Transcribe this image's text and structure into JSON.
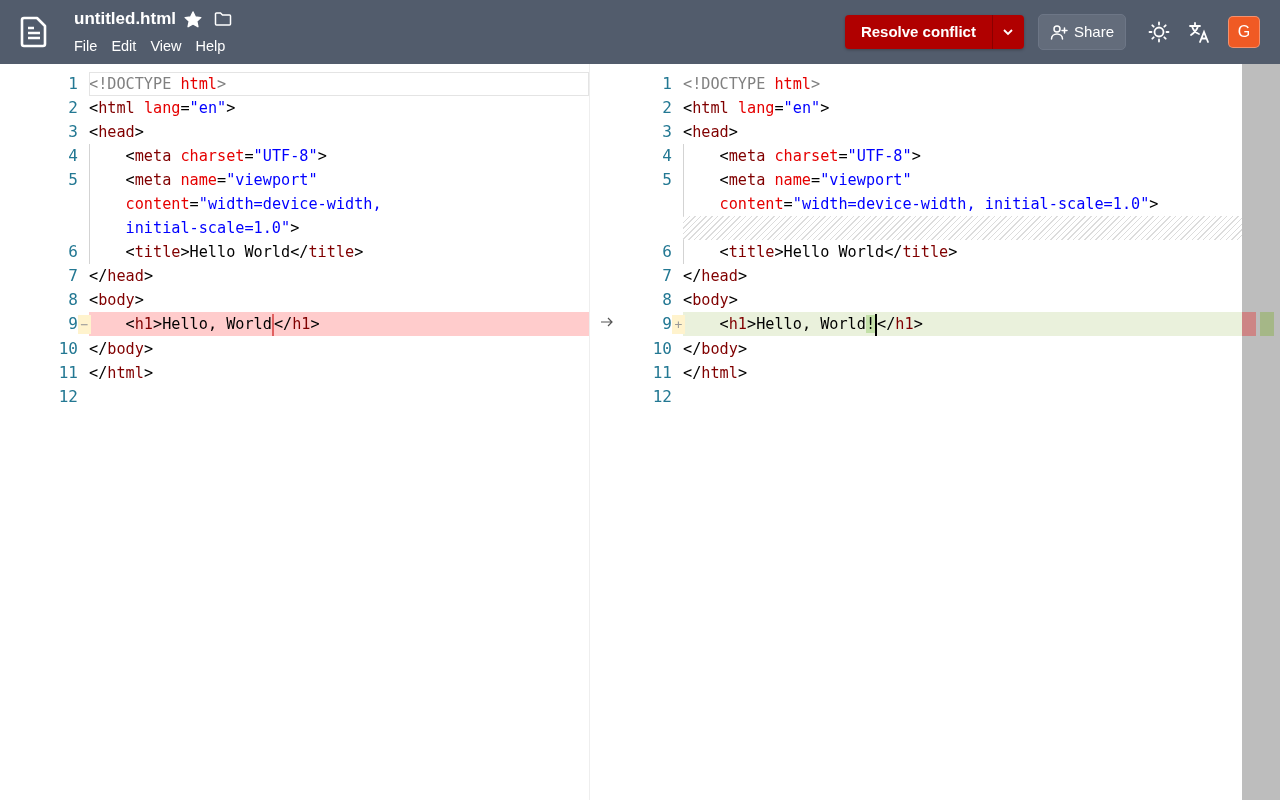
{
  "header": {
    "file_name": "untitled.html",
    "starred": true,
    "menu": [
      "File",
      "Edit",
      "View",
      "Help"
    ],
    "resolve_button": "Resolve conflict",
    "share_button": "Share",
    "avatar": "G"
  },
  "panes": [
    {
      "lines": [
        {
          "kind": "line",
          "number": "1",
          "removed": false,
          "active": true,
          "rows": [
            {
              "tokens": [
                {
                  "kind": "doc",
                  "text": "<!DOCTYPE "
                },
                {
                  "kind": "attr",
                  "text": "html"
                },
                {
                  "kind": "doc",
                  "text": ">"
                }
              ]
            }
          ]
        },
        {
          "kind": "line",
          "number": "2",
          "removed": false,
          "active": false,
          "rows": [
            {
              "tokens": [
                {
                  "kind": "p",
                  "text": "<"
                },
                {
                  "kind": "tag",
                  "text": "html "
                },
                {
                  "kind": "attr",
                  "text": "lang"
                },
                {
                  "kind": "p",
                  "text": "="
                },
                {
                  "kind": "str",
                  "text": "\"en\""
                },
                {
                  "kind": "p",
                  "text": ">"
                }
              ]
            }
          ]
        },
        {
          "kind": "line",
          "number": "3",
          "removed": false,
          "active": false,
          "rows": [
            {
              "tokens": [
                {
                  "kind": "p",
                  "text": "<"
                },
                {
                  "kind": "tag",
                  "text": "head"
                },
                {
                  "kind": "p",
                  "text": ">"
                }
              ]
            }
          ]
        },
        {
          "kind": "line",
          "number": "4",
          "removed": false,
          "active": false,
          "rows": [
            {
              "tokens": [
                {
                  "kind": "indent"
                },
                {
                  "kind": "p",
                  "text": "<"
                },
                {
                  "kind": "tag",
                  "text": "meta "
                },
                {
                  "kind": "attr",
                  "text": "charset"
                },
                {
                  "kind": "p",
                  "text": "="
                },
                {
                  "kind": "str",
                  "text": "\"UTF-8\""
                },
                {
                  "kind": "p",
                  "text": ">"
                }
              ]
            }
          ]
        },
        {
          "kind": "line",
          "number": "5",
          "removed": false,
          "active": false,
          "rows": [
            {
              "tokens": [
                {
                  "kind": "indent"
                },
                {
                  "kind": "p",
                  "text": "<"
                },
                {
                  "kind": "tag",
                  "text": "meta "
                },
                {
                  "kind": "attr",
                  "text": "name"
                },
                {
                  "kind": "p",
                  "text": "="
                },
                {
                  "kind": "str",
                  "text": "\"viewport\""
                }
              ]
            },
            {
              "tokens": [
                {
                  "kind": "indent"
                },
                {
                  "kind": "attr",
                  "text": "content"
                },
                {
                  "kind": "p",
                  "text": "="
                },
                {
                  "kind": "str",
                  "text": "\"width=device-width,"
                }
              ]
            },
            {
              "tokens": [
                {
                  "kind": "indent"
                },
                {
                  "kind": "str",
                  "text": "initial-scale=1.0\""
                },
                {
                  "kind": "p",
                  "text": ">"
                }
              ]
            }
          ]
        },
        {
          "kind": "line",
          "number": "6",
          "removed": false,
          "active": false,
          "rows": [
            {
              "tokens": [
                {
                  "kind": "indent"
                },
                {
                  "kind": "p",
                  "text": "<"
                },
                {
                  "kind": "tag",
                  "text": "title"
                },
                {
                  "kind": "p",
                  "text": ">Hello World</"
                },
                {
                  "kind": "tag",
                  "text": "title"
                },
                {
                  "kind": "p",
                  "text": ">"
                }
              ]
            }
          ]
        },
        {
          "kind": "line",
          "number": "7",
          "removed": false,
          "active": false,
          "rows": [
            {
              "tokens": [
                {
                  "kind": "p",
                  "text": "</"
                },
                {
                  "kind": "tag",
                  "text": "head"
                },
                {
                  "kind": "p",
                  "text": ">"
                }
              ]
            }
          ]
        },
        {
          "kind": "line",
          "number": "8",
          "removed": false,
          "active": false,
          "rows": [
            {
              "tokens": [
                {
                  "kind": "p",
                  "text": "<"
                },
                {
                  "kind": "tag",
                  "text": "body"
                },
                {
                  "kind": "p",
                  "text": ">"
                }
              ]
            }
          ]
        },
        {
          "kind": "line",
          "number": "9",
          "removed": true,
          "active": false,
          "marker": "−",
          "rows": [
            {
              "tokens": [
                {
                  "kind": "p",
                  "text": "    <"
                },
                {
                  "kind": "tag",
                  "text": "h1"
                },
                {
                  "kind": "p",
                  "text": ">Hello, World"
                },
                {
                  "kind": "caret"
                },
                {
                  "kind": "p",
                  "text": "</"
                },
                {
                  "kind": "tag",
                  "text": "h1"
                },
                {
                  "kind": "p",
                  "text": ">"
                }
              ]
            }
          ]
        },
        {
          "kind": "line",
          "number": "10",
          "removed": false,
          "active": false,
          "rows": [
            {
              "tokens": [
                {
                  "kind": "p",
                  "text": "</"
                },
                {
                  "kind": "tag",
                  "text": "body"
                },
                {
                  "kind": "p",
                  "text": ">"
                }
              ]
            }
          ]
        },
        {
          "kind": "line",
          "number": "11",
          "removed": false,
          "active": false,
          "rows": [
            {
              "tokens": [
                {
                  "kind": "p",
                  "text": "</"
                },
                {
                  "kind": "tag",
                  "text": "html"
                },
                {
                  "kind": "p",
                  "text": ">"
                }
              ]
            }
          ]
        },
        {
          "kind": "line",
          "number": "12",
          "removed": false,
          "active": false
        }
      ]
    },
    {
      "lines": [
        {
          "kind": "line",
          "number": "1",
          "added": false,
          "rows": [
            {
              "tokens": [
                {
                  "kind": "doc",
                  "text": "<!DOCTYPE "
                },
                {
                  "kind": "attr",
                  "text": "html"
                },
                {
                  "kind": "doc",
                  "text": ">"
                }
              ]
            }
          ]
        },
        {
          "kind": "line",
          "number": "2",
          "added": false,
          "rows": [
            {
              "tokens": [
                {
                  "kind": "p",
                  "text": "<"
                },
                {
                  "kind": "tag",
                  "text": "html "
                },
                {
                  "kind": "attr",
                  "text": "lang"
                },
                {
                  "kind": "p",
                  "text": "="
                },
                {
                  "kind": "str",
                  "text": "\"en\""
                },
                {
                  "kind": "p",
                  "text": ">"
                }
              ]
            }
          ]
        },
        {
          "kind": "line",
          "number": "3",
          "added": false,
          "rows": [
            {
              "tokens": [
                {
                  "kind": "p",
                  "text": "<"
                },
                {
                  "kind": "tag",
                  "text": "head"
                },
                {
                  "kind": "p",
                  "text": ">"
                }
              ]
            }
          ]
        },
        {
          "kind": "line",
          "number": "4",
          "added": false,
          "rows": [
            {
              "tokens": [
                {
                  "kind": "indent"
                },
                {
                  "kind": "p",
                  "text": "<"
                },
                {
                  "kind": "tag",
                  "text": "meta "
                },
                {
                  "kind": "attr",
                  "text": "charset"
                },
                {
                  "kind": "p",
                  "text": "="
                },
                {
                  "kind": "str",
                  "text": "\"UTF-8\""
                },
                {
                  "kind": "p",
                  "text": ">"
                }
              ]
            }
          ]
        },
        {
          "kind": "line",
          "number": "5",
          "added": false,
          "rows": [
            {
              "tokens": [
                {
                  "kind": "indent"
                },
                {
                  "kind": "p",
                  "text": "<"
                },
                {
                  "kind": "tag",
                  "text": "meta "
                },
                {
                  "kind": "attr",
                  "text": "name"
                },
                {
                  "kind": "p",
                  "text": "="
                },
                {
                  "kind": "str",
                  "text": "\"viewport\""
                }
              ]
            },
            {
              "tokens": [
                {
                  "kind": "indent"
                },
                {
                  "kind": "attr",
                  "text": "content"
                },
                {
                  "kind": "p",
                  "text": "="
                },
                {
                  "kind": "str",
                  "text": "\"width=device-width, initial-scale=1.0\""
                },
                {
                  "kind": "p",
                  "text": ">"
                }
              ]
            }
          ]
        },
        {
          "kind": "filler"
        },
        {
          "kind": "line",
          "number": "6",
          "added": false,
          "rows": [
            {
              "tokens": [
                {
                  "kind": "indent"
                },
                {
                  "kind": "p",
                  "text": "<"
                },
                {
                  "kind": "tag",
                  "text": "title"
                },
                {
                  "kind": "p",
                  "text": ">Hello World</"
                },
                {
                  "kind": "tag",
                  "text": "title"
                },
                {
                  "kind": "p",
                  "text": ">"
                }
              ]
            }
          ]
        },
        {
          "kind": "line",
          "number": "7",
          "added": false,
          "rows": [
            {
              "tokens": [
                {
                  "kind": "p",
                  "text": "</"
                },
                {
                  "kind": "tag",
                  "text": "head"
                },
                {
                  "kind": "p",
                  "text": ">"
                }
              ]
            }
          ]
        },
        {
          "kind": "line",
          "number": "8",
          "added": false,
          "rows": [
            {
              "tokens": [
                {
                  "kind": "p",
                  "text": "<"
                },
                {
                  "kind": "tag",
                  "text": "body"
                },
                {
                  "kind": "p",
                  "text": ">"
                }
              ]
            }
          ]
        },
        {
          "kind": "line",
          "number": "9",
          "added": true,
          "marker": "+",
          "rows": [
            {
              "tokens": [
                {
                  "kind": "p",
                  "text": "    <"
                },
                {
                  "kind": "tag",
                  "text": "h1"
                },
                {
                  "kind": "p",
                  "text": ">Hello, World"
                },
                {
                  "kind": "ins",
                  "text": "!"
                },
                {
                  "kind": "caret"
                },
                {
                  "kind": "p",
                  "text": "</"
                },
                {
                  "kind": "tag",
                  "text": "h1"
                },
                {
                  "kind": "p",
                  "text": ">"
                }
              ]
            }
          ]
        },
        {
          "kind": "line",
          "number": "10",
          "added": false,
          "rows": [
            {
              "tokens": [
                {
                  "kind": "p",
                  "text": "</"
                },
                {
                  "kind": "tag",
                  "text": "body"
                },
                {
                  "kind": "p",
                  "text": ">"
                }
              ]
            }
          ]
        },
        {
          "kind": "line",
          "number": "11",
          "added": false,
          "rows": [
            {
              "tokens": [
                {
                  "kind": "p",
                  "text": "</"
                },
                {
                  "kind": "tag",
                  "text": "html"
                },
                {
                  "kind": "p",
                  "text": ">"
                }
              ]
            }
          ]
        },
        {
          "kind": "line",
          "number": "12",
          "added": false
        }
      ]
    }
  ]
}
